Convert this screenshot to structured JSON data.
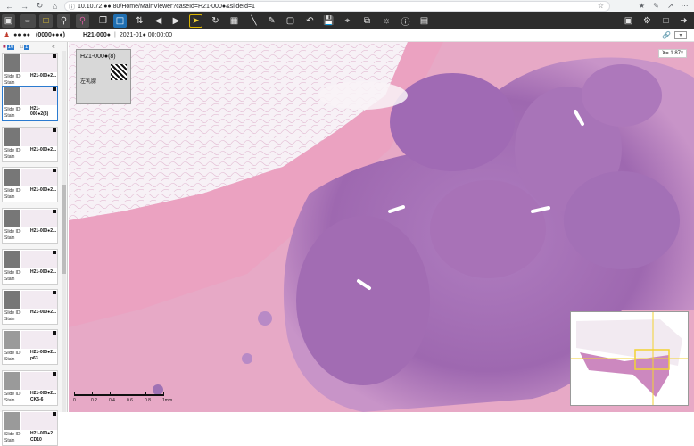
{
  "browser": {
    "back_icon": "arrow-left",
    "forward_icon": "arrow-right",
    "reload_icon": "reload",
    "home_icon": "home",
    "url": "10.10.72.●●:80/Home/MainViewer?caseId=H21-000●&slideId=1"
  },
  "case_info": {
    "patient_name": "●●  ●●",
    "patient_id": "(0000●●●)",
    "case_id": "H21-000●",
    "date": "2021-01●  00:00:00"
  },
  "sidebar": {
    "tab_count_1": "10",
    "tab_count_2": "1",
    "slides": [
      {
        "label1": "Slide ID",
        "label2": "Stain",
        "id": "H21-000●2...",
        "stain": ""
      },
      {
        "label1": "Slide ID",
        "label2": "Stain",
        "id": "H21-000●2(8)",
        "stain": ""
      },
      {
        "label1": "Slide ID",
        "label2": "Stain",
        "id": "H21-000●2...",
        "stain": ""
      },
      {
        "label1": "Slide ID",
        "label2": "Stain",
        "id": "H21-000●2...",
        "stain": ""
      },
      {
        "label1": "Slide ID",
        "label2": "Stain",
        "id": "H21-000●2...",
        "stain": ""
      },
      {
        "label1": "Slide ID",
        "label2": "Stain",
        "id": "H21-000●2...",
        "stain": ""
      },
      {
        "label1": "Slide ID",
        "label2": "Stain",
        "id": "H21-000●2...",
        "stain": ""
      },
      {
        "label1": "Slide ID",
        "label2": "Stain",
        "id": "H21-000●2...",
        "stain": "p63"
      },
      {
        "label1": "Slide ID",
        "label2": "Stain",
        "id": "H21-000●2...",
        "stain": "CK5-6"
      },
      {
        "label1": "Slide ID",
        "label2": "Stain",
        "id": "H21-000●2...",
        "stain": "CD10"
      }
    ]
  },
  "viewer": {
    "zoom": "X= 1.87x",
    "slide_label_top": "H21-000●(8)",
    "slide_label_bottom": "左乳腺",
    "scale": [
      "0",
      "0.2",
      "0.4",
      "0.6",
      "0.8",
      "1mm"
    ]
  },
  "colors": {
    "tissue_pink": "#e8a9c4",
    "tumor_purple": "#a86fb5",
    "fat_white": "#f6f1f5",
    "toolbar_bg": "#2d2d2d",
    "accent_yellow": "#f2d233"
  }
}
